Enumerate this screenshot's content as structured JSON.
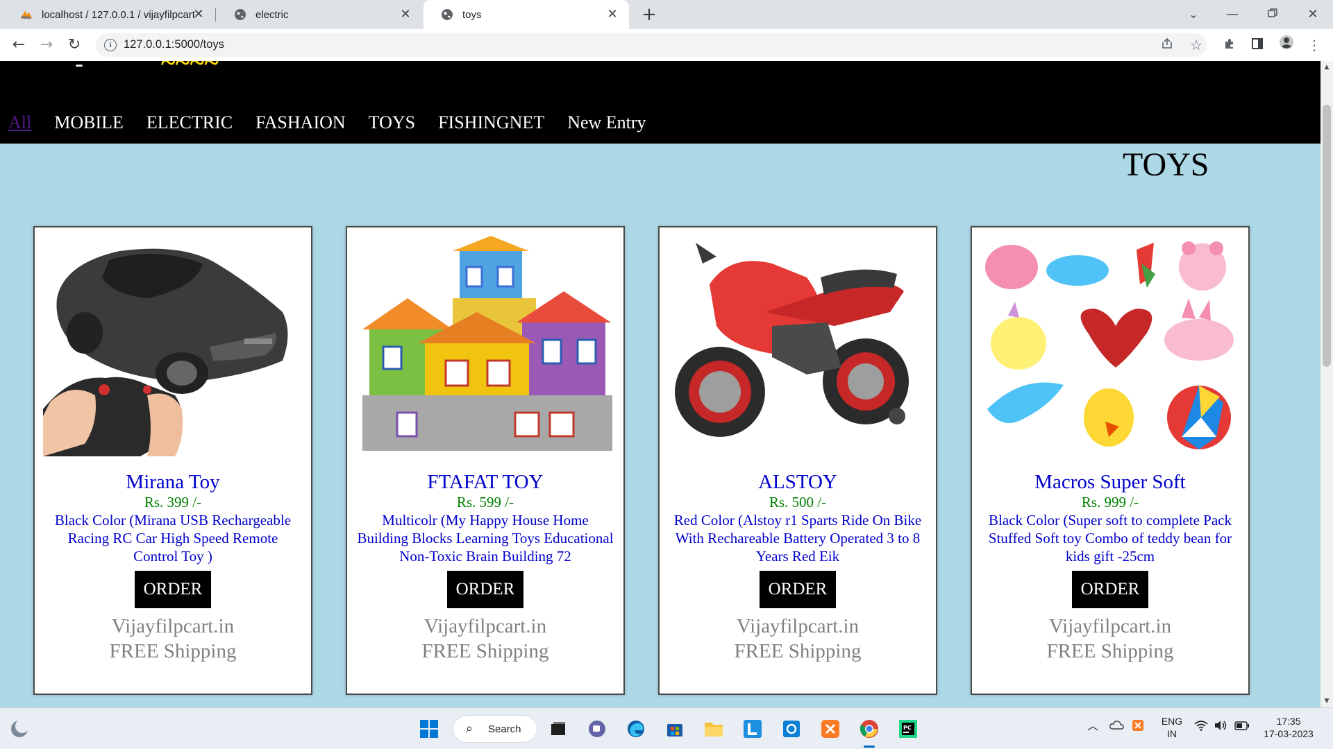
{
  "browser": {
    "tabs": [
      {
        "title": "localhost / 127.0.0.1 / vijayfilpcart",
        "active": false,
        "icon": "phpmyadmin-icon"
      },
      {
        "title": "electric",
        "active": false,
        "icon": "globe-icon"
      },
      {
        "title": "toys",
        "active": true,
        "icon": "globe-icon"
      }
    ],
    "new_tab_symbol": "+",
    "url": "127.0.0.1:5000/toys"
  },
  "site": {
    "nav": [
      {
        "label": "All",
        "current": true
      },
      {
        "label": "MOBILE",
        "current": false
      },
      {
        "label": "ELECTRIC",
        "current": false
      },
      {
        "label": "FASHAION",
        "current": false
      },
      {
        "label": "TOYS",
        "current": false
      },
      {
        "label": "FISHINGNET",
        "current": false
      },
      {
        "label": "New Entry",
        "current": false
      }
    ],
    "category_heading": "TOYS",
    "products": [
      {
        "name": "Mirana Toy",
        "price": "Rs. 399 /-",
        "description": "Black Color (Mirana USB Rechargeable Racing RC Car High Speed Remote Control Toy )",
        "order_label": "ORDER",
        "brand": "Vijayfilpcart.in",
        "shipping": "FREE Shipping",
        "image": "rc-car-image"
      },
      {
        "name": "FTAFAT TOY",
        "price": "Rs. 599 /-",
        "description": "Multicolr (My Happy House Home Building Blocks Learning Toys Educational Non-Toxic Brain Building 72",
        "order_label": "ORDER",
        "brand": "Vijayfilpcart.in",
        "shipping": "FREE Shipping",
        "image": "building-blocks-image"
      },
      {
        "name": "ALSTOY",
        "price": "Rs. 500 /-",
        "description": "Red Color (Alstoy r1 Sparts Ride On Bike With Rechareable Battery Operated 3 to 8 Years Red Eik",
        "order_label": "ORDER",
        "brand": "Vijayfilpcart.in",
        "shipping": "FREE Shipping",
        "image": "ride-on-bike-image"
      },
      {
        "name": "Macros Super Soft",
        "price": "Rs. 999 /-",
        "description": "Black Color (Super soft to complete Pack Stuffed Soft toy Combo of teddy bean for kids gift -25cm",
        "order_label": "ORDER",
        "brand": "Vijayfilpcart.in",
        "shipping": "FREE Shipping",
        "image": "soft-toys-image"
      }
    ]
  },
  "taskbar": {
    "search_label": "Search",
    "language": "ENG",
    "region": "IN",
    "time": "17:35",
    "date": "17-03-2023"
  },
  "colors": {
    "page_bg": "#add8e6",
    "header_bg": "#000000",
    "product_name": "#0000cd",
    "price": "#008000",
    "brand_text": "#808080",
    "accent_logo": "#ffd700"
  }
}
